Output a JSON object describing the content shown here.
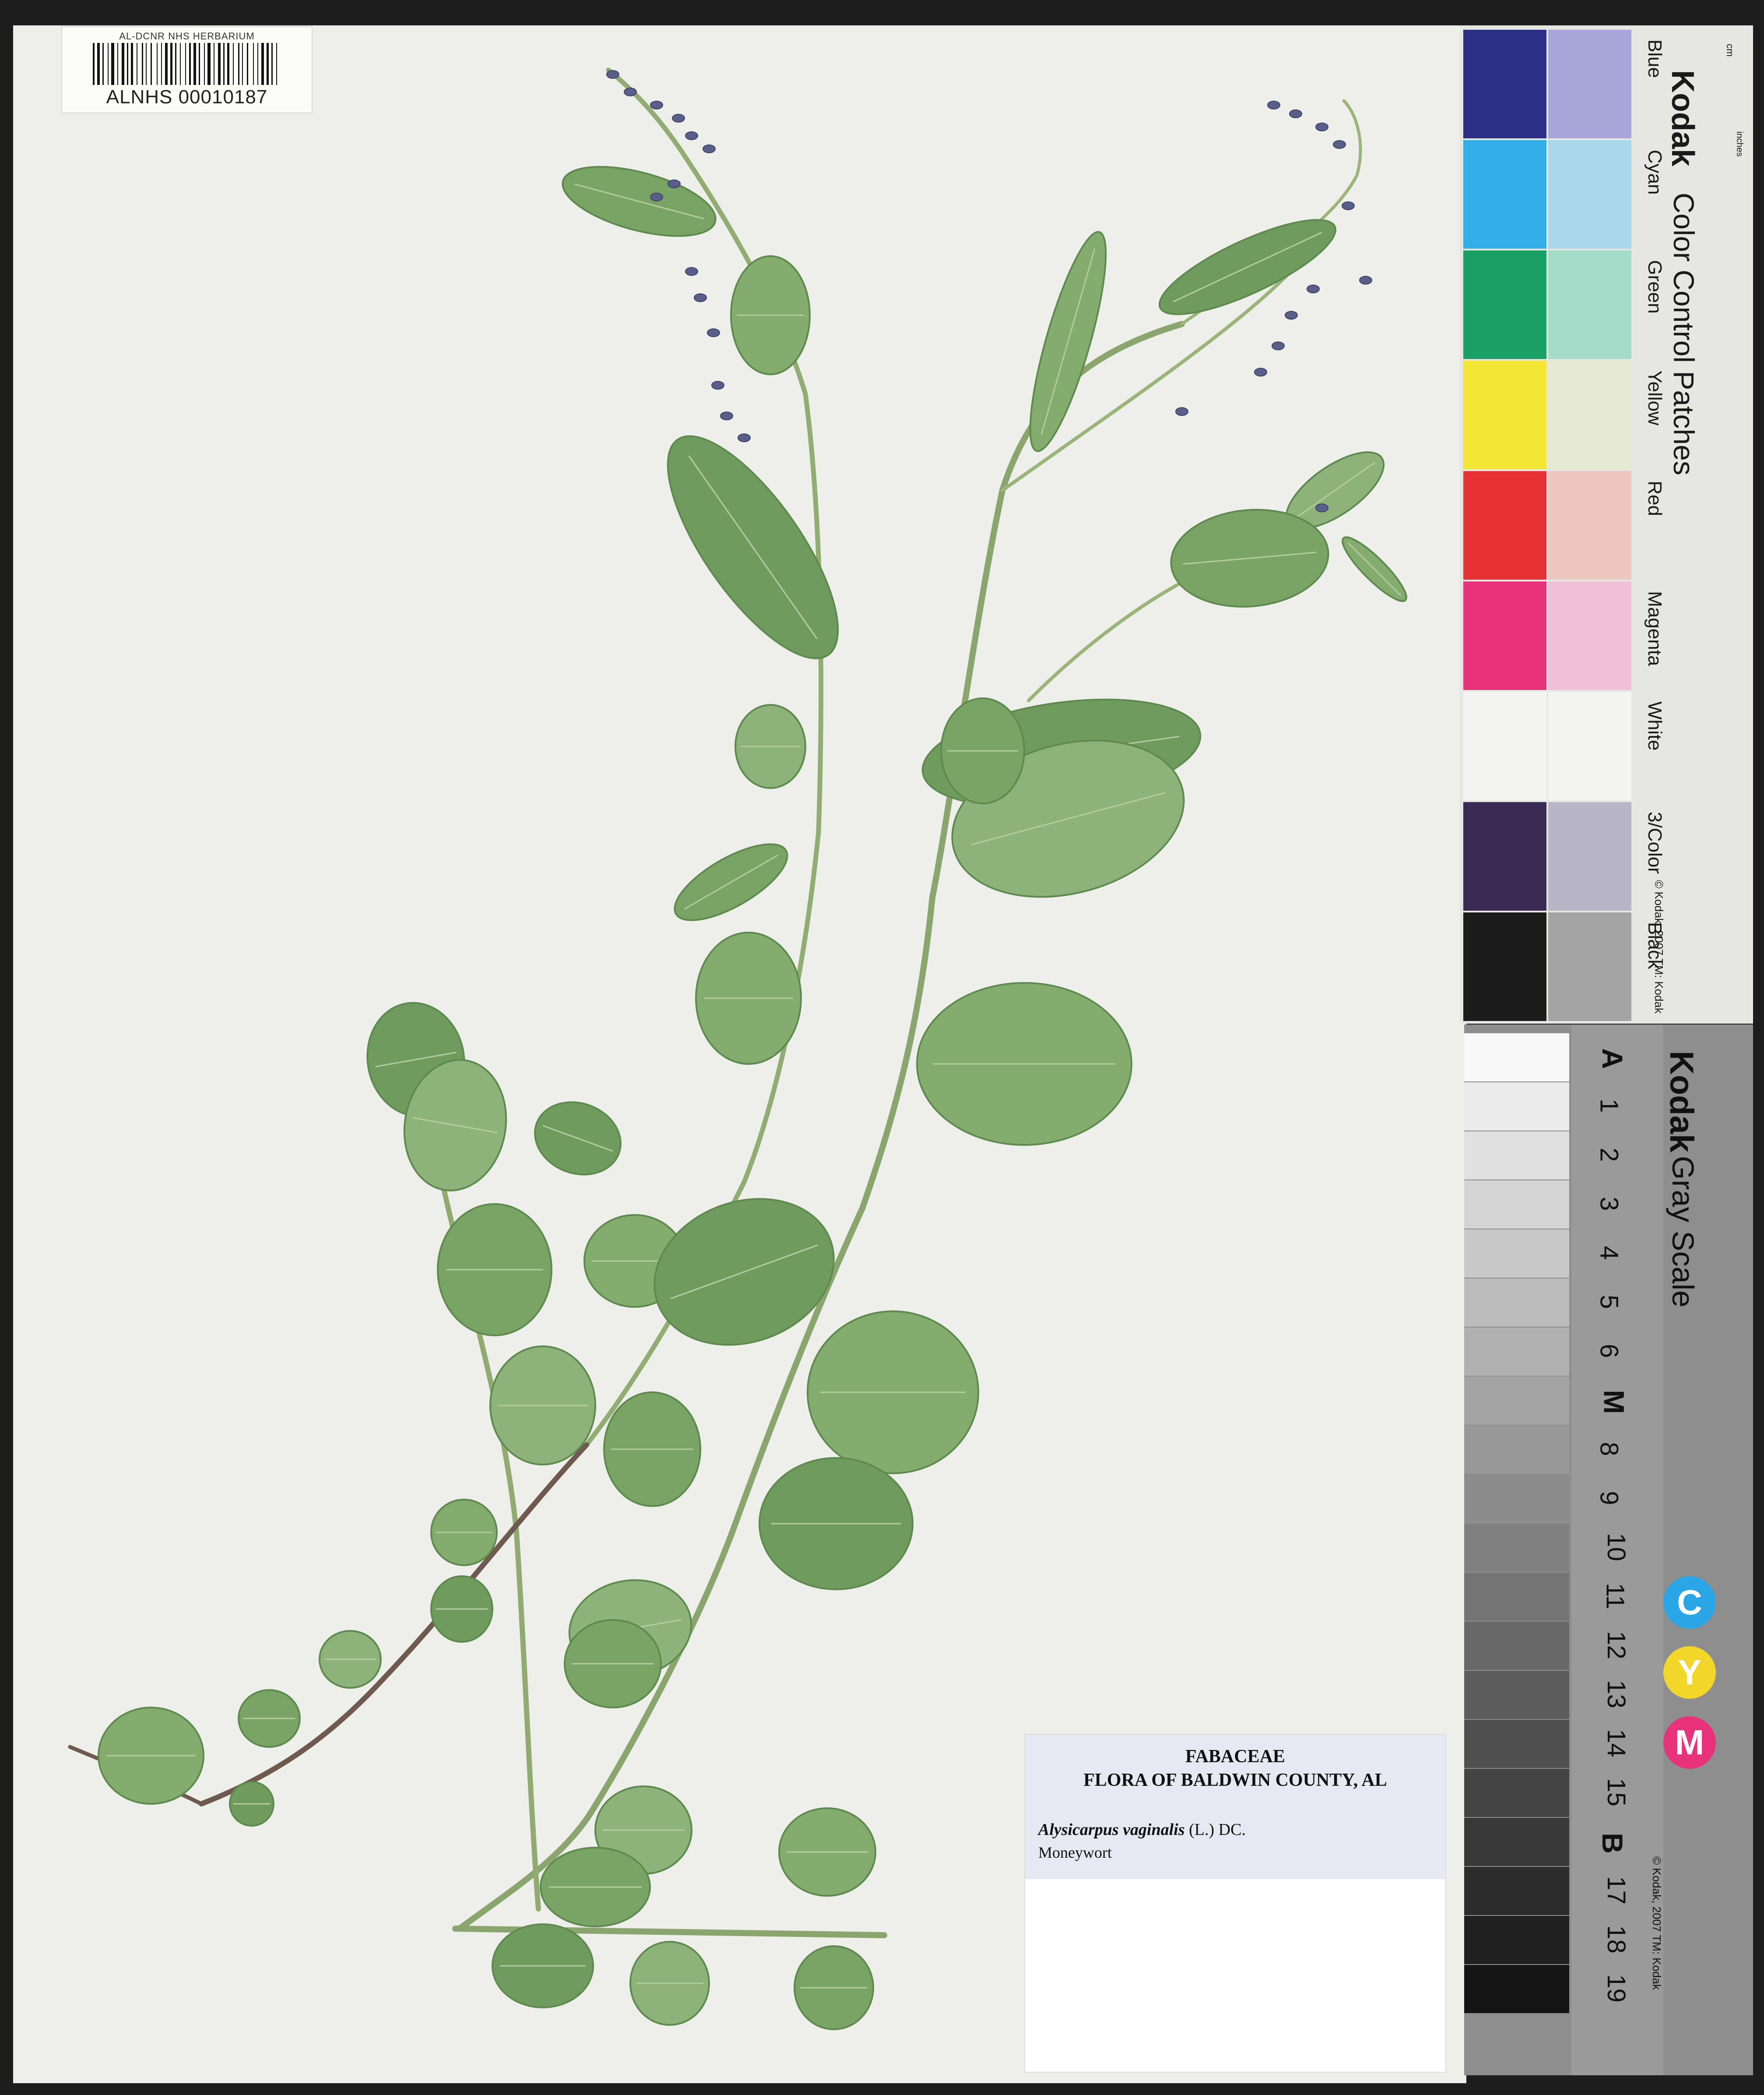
{
  "barcode_label": {
    "title": "AL-DCNR NHS HERBARIUM",
    "id": "ALNHS 00010187"
  },
  "specimen_label": {
    "family": "FABACEAE",
    "flora": "FLORA OF BALDWIN COUNTY, AL",
    "scientific_name": "Alysicarpus vaginalis",
    "author": "(L.) DC.",
    "common_name": "Moneywort"
  },
  "color_card": {
    "brand": "Kodak",
    "title": "Color Control Patches",
    "copyright": "© Kodak, 2007 TM: Kodak",
    "ruler_unit_cm": "cm",
    "ruler_unit_in": "inches",
    "patch_names": [
      "Blue",
      "Cyan",
      "Green",
      "Yellow",
      "Red",
      "Magenta",
      "White",
      "3/Color",
      "Black"
    ],
    "patch_colors": [
      "#2b2f86",
      "#34aee8",
      "#1aa065",
      "#f4e634",
      "#e63234",
      "#e8327c",
      "#f4f4f2",
      "#3a2a54",
      "#1c1c1c"
    ],
    "tint_colors": [
      "#a8a6d8",
      "#a9d7ec",
      "#a5dcc9",
      "#e6ead2",
      "#f0c6c0",
      "#efc0d6",
      "#f4f4f2",
      "#b8b6c6",
      "#a4a4a4"
    ]
  },
  "gray_card": {
    "brand": "Kodak",
    "title": "Gray Scale",
    "copyright": "© Kodak, 2007 TM: Kodak",
    "steps": [
      "A",
      "1",
      "2",
      "3",
      "4",
      "5",
      "6",
      "M",
      "8",
      "9",
      "10",
      "11",
      "12",
      "13",
      "14",
      "15",
      "B",
      "17",
      "18",
      "19"
    ],
    "cym_letters": [
      "C",
      "Y",
      "M"
    ],
    "cym_colors": [
      "#2aa6e6",
      "#f2d62a",
      "#e8327c"
    ]
  }
}
